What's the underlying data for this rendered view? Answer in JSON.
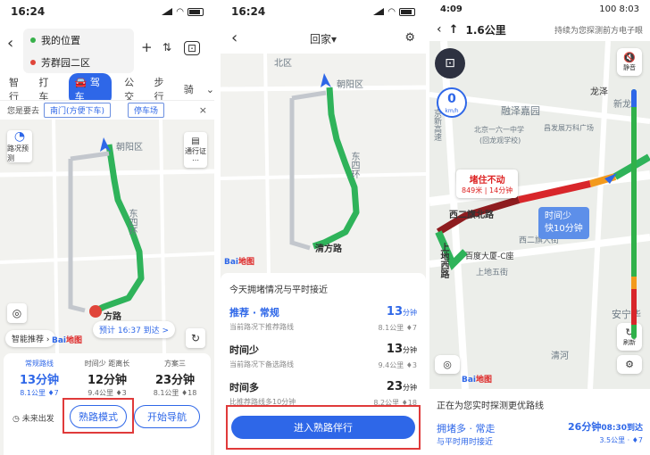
{
  "panel1": {
    "status_time": "16:24",
    "origin": "我的位置",
    "destination": "芳群园二区",
    "modes": [
      "智行",
      "打车",
      "驾车",
      "公交",
      "步行",
      "骑"
    ],
    "todo_label": "您是要去",
    "todo_chips": [
      "南门(方便下车)",
      "停车场"
    ],
    "traffic_btn": "路况预测",
    "permit_btn": "通行证",
    "map_labels": {
      "district": "朝阳区",
      "ring": "东四环",
      "dest_label": "方路"
    },
    "eta_pill": "预计 16:37 到达 >",
    "smart_pill": "智能推荐",
    "baidu": "Bai",
    "baidu_red": "地图",
    "routes": [
      {
        "tag": "常规路线",
        "time": "13分钟",
        "sub": "8.1公里 ♦7"
      },
      {
        "tag": "时间少 距离长",
        "time": "12分钟",
        "sub": "9.4公里 ♦3"
      },
      {
        "tag": "方案三",
        "time": "23分钟",
        "sub": "8.1公里 ♦18"
      }
    ],
    "future_btn": "未来出发",
    "familiar_btn": "熟路模式",
    "start_btn": "开始导航"
  },
  "panel2": {
    "status_time": "16:24",
    "title": "回家▾",
    "map_labels": {
      "district": "朝阳区",
      "ring": "东四环",
      "north": "北区",
      "dest": "清方路"
    },
    "baidu": "Bai",
    "baidu_red": "地图",
    "sheet_title": "今天拥堵情况与平时接近",
    "rows": [
      {
        "name": "推荐 · 常规",
        "desc": "当前路况下推荐路线",
        "time": "13",
        "unit": "分钟",
        "meta": "8.1公里 ♦7",
        "blue": true
      },
      {
        "name": "时间少",
        "desc": "当前路况下备选路线",
        "time": "13",
        "unit": "分钟",
        "meta": "9.4公里 ♦3",
        "blue": false
      },
      {
        "name": "时间多",
        "desc": "比推荐路线多10分钟",
        "time": "23",
        "unit": "分钟",
        "meta": "8.2公里 ♦18",
        "blue": false
      }
    ],
    "enter_btn": "进入熟路伴行"
  },
  "panel3": {
    "status_time": "4:09",
    "status_right": "100 8:03",
    "distance": "1.6公里",
    "hint": "持续为您探测前方电子眼",
    "speed": "0",
    "speed_unit": "km/h",
    "mute_label": "静音",
    "refresh_label": "刷新",
    "map_labels": {
      "a": "融泽嘉园",
      "b": "北京一六一中学",
      "c": "(回龙观学校)",
      "d": "昌发展万科广场",
      "e": "西二旗北路",
      "f": "百度大厦-C座",
      "g": "上地西路",
      "h": "安宁华",
      "i": "清河",
      "j": "龙泽",
      "k": "新龙",
      "l": "西二旗大街",
      "m": "上地五街",
      "n": "京新高速"
    },
    "jam_title": "堵住不动",
    "jam_sub": "849米 | 14分钟",
    "less_time_title": "时间少",
    "less_time_sub": "快10分钟",
    "bottom_title": "正在为您实时探测更优路线",
    "bottom_route": "拥堵多 · 常走",
    "bottom_desc": "与平时用时接近",
    "bottom_time": "26分钟",
    "bottom_arrive": "08:30到达",
    "bottom_meta": "3.5公里 · ♦7",
    "baidu": "Bai",
    "baidu_red": "地图"
  },
  "colors": {
    "accent": "#2e67e8",
    "route_green": "#2fb35a",
    "jam_red": "#d8262a",
    "slow_orange": "#f39a1d",
    "highlight_box": "#e03a3a"
  }
}
